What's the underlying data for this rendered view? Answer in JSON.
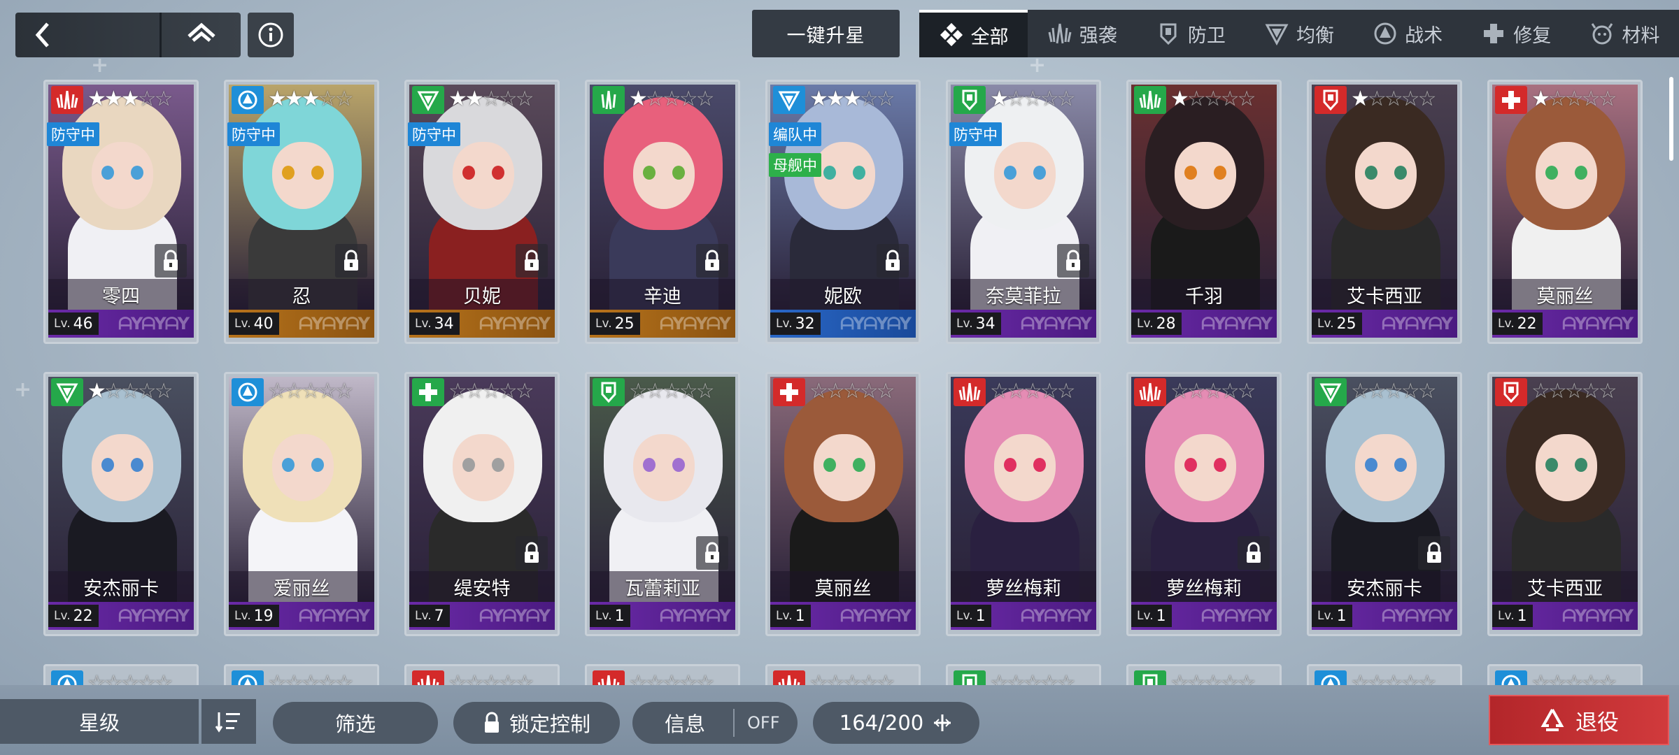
{
  "topbar": {
    "back_icon": "chevron-left-icon",
    "home_icon": "home-icon",
    "info_icon": "info-icon",
    "upgrade_label": "一键升星",
    "tabs": [
      {
        "label": "全部",
        "icon": "all-icon",
        "active": true
      },
      {
        "label": "强袭",
        "icon": "assault-icon"
      },
      {
        "label": "防卫",
        "icon": "defense-icon"
      },
      {
        "label": "均衡",
        "icon": "balance-icon"
      },
      {
        "label": "战术",
        "icon": "tactic-icon"
      },
      {
        "label": "修复",
        "icon": "repair-icon"
      },
      {
        "label": "材料",
        "icon": "material-icon"
      }
    ]
  },
  "cards": [
    {
      "name": "零四",
      "level": "46",
      "lv_label": "Lv.",
      "class": "assault",
      "stars": 3,
      "badges": [
        "防守中"
      ],
      "locked": true,
      "frame": "purple"
    },
    {
      "name": "忍",
      "level": "40",
      "lv_label": "Lv.",
      "class": "tactic",
      "stars": 3,
      "badges": [
        "防守中"
      ],
      "locked": true,
      "frame": "orange"
    },
    {
      "name": "贝妮",
      "level": "34",
      "lv_label": "Lv.",
      "class": "balance",
      "stars": 2,
      "badges": [
        "防守中"
      ],
      "locked": true,
      "frame": "orange"
    },
    {
      "name": "辛迪",
      "level": "25",
      "lv_label": "Lv.",
      "class": "balance-assault",
      "stars": 1,
      "badges": [],
      "locked": true,
      "frame": "orange"
    },
    {
      "name": "妮欧",
      "level": "32",
      "lv_label": "Lv.",
      "class": "tactic-blue",
      "stars": 3,
      "badges": [
        "编队中",
        "母舰中"
      ],
      "locked": true,
      "frame": "blue"
    },
    {
      "name": "奈莫菲拉",
      "level": "34",
      "lv_label": "Lv.",
      "class": "defense-green",
      "stars": 1,
      "badges": [
        "防守中"
      ],
      "locked": true,
      "frame": "purple"
    },
    {
      "name": "千羽",
      "level": "28",
      "lv_label": "Lv.",
      "class": "assault-green",
      "stars": 1,
      "badges": [],
      "locked": false,
      "frame": "purple"
    },
    {
      "name": "艾卡西亚",
      "level": "25",
      "lv_label": "Lv.",
      "class": "defense",
      "stars": 1,
      "badges": [],
      "locked": false,
      "frame": "purple"
    },
    {
      "name": "莫丽丝",
      "level": "22",
      "lv_label": "Lv.",
      "class": "repair",
      "stars": 1,
      "badges": [],
      "locked": false,
      "frame": "purple"
    },
    {
      "name": "安杰丽卡",
      "level": "22",
      "lv_label": "Lv.",
      "class": "balance",
      "stars": 1,
      "badges": [],
      "locked": false,
      "frame": "purple"
    },
    {
      "name": "爱丽丝",
      "level": "19",
      "lv_label": "Lv.",
      "class": "tactic",
      "stars": 0,
      "badges": [],
      "locked": false,
      "frame": "purple"
    },
    {
      "name": "缇安特",
      "level": "7",
      "lv_label": "Lv.",
      "class": "repair-green",
      "stars": 0,
      "badges": [],
      "locked": true,
      "frame": "purple"
    },
    {
      "name": "瓦蕾莉亚",
      "level": "1",
      "lv_label": "Lv.",
      "class": "defense-green",
      "stars": 0,
      "badges": [],
      "locked": true,
      "frame": "purple"
    },
    {
      "name": "莫丽丝",
      "level": "1",
      "lv_label": "Lv.",
      "class": "repair",
      "stars": 0,
      "badges": [],
      "locked": false,
      "frame": "purple"
    },
    {
      "name": "萝丝梅莉",
      "level": "1",
      "lv_label": "Lv.",
      "class": "assault",
      "stars": 0,
      "badges": [],
      "locked": false,
      "frame": "purple"
    },
    {
      "name": "萝丝梅莉",
      "level": "1",
      "lv_label": "Lv.",
      "class": "assault",
      "stars": 0,
      "badges": [],
      "locked": true,
      "frame": "purple"
    },
    {
      "name": "安杰丽卡",
      "level": "1",
      "lv_label": "Lv.",
      "class": "balance",
      "stars": 0,
      "badges": [],
      "locked": true,
      "frame": "purple"
    },
    {
      "name": "艾卡西亚",
      "level": "1",
      "lv_label": "Lv.",
      "class": "defense",
      "stars": 0,
      "badges": [],
      "locked": false,
      "frame": "purple"
    }
  ],
  "partial_row_classes": [
    "tactic",
    "tactic",
    "assault",
    "assault",
    "assault",
    "defense-green",
    "defense-green",
    "tactic",
    "tactic"
  ],
  "bottombar": {
    "star_sort_label": "星级",
    "sort_icon": "sort-order-icon",
    "filter_label": "筛选",
    "lock_label": "锁定控制",
    "lock_icon": "lock-icon",
    "info_label": "信息",
    "info_toggle": "OFF",
    "capacity": "164/200",
    "expand_icon": "plus-icon",
    "retire_label": "退役",
    "retire_icon": "recycle-icon"
  },
  "colors": {
    "assault": "#d42a2a",
    "tactic": "#1e8fd8",
    "balance": "#25a84a",
    "defense": "#d42a2a",
    "repair": "#d42a2a",
    "badge_blue": "#1f86d6",
    "badge_green": "#2db04a",
    "retire": "#c22f32"
  }
}
